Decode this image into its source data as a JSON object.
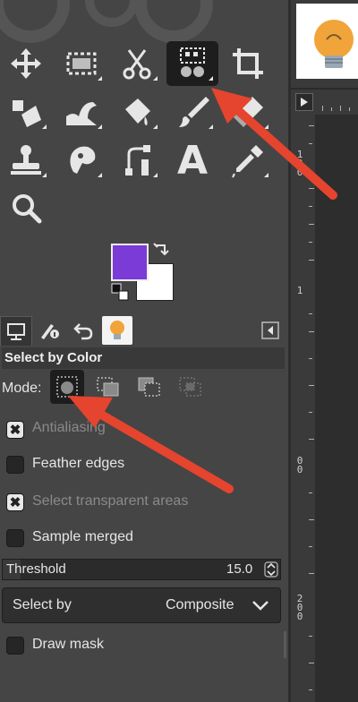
{
  "toolbox": {
    "tools": [
      {
        "name": "move-tool"
      },
      {
        "name": "rect-select-tool"
      },
      {
        "name": "scissors-select-tool"
      },
      {
        "name": "select-by-color-tool",
        "active": true
      },
      {
        "name": "crop-tool"
      },
      {
        "name": "unified-transform-tool"
      },
      {
        "name": "warp-transform-tool"
      },
      {
        "name": "bucket-fill-tool"
      },
      {
        "name": "paintbrush-tool"
      },
      {
        "name": "eraser-tool"
      },
      {
        "name": "clone-tool"
      },
      {
        "name": "smudge-tool"
      },
      {
        "name": "paths-tool"
      },
      {
        "name": "text-tool"
      },
      {
        "name": "color-picker-tool"
      },
      {
        "name": "zoom-tool"
      }
    ],
    "text_tool_glyph": "A"
  },
  "colors": {
    "foreground": "#7a3bd6",
    "background": "#ffffff"
  },
  "tool_options": {
    "title": "Select by Color",
    "mode_label": "Mode:",
    "antialiasing": {
      "label": "Antialiasing",
      "checked": true,
      "enabled": false
    },
    "feather_edges": {
      "label": "Feather edges",
      "checked": false
    },
    "select_transparent": {
      "label": "Select transparent areas",
      "checked": true,
      "enabled": false
    },
    "sample_merged": {
      "label": "Sample merged",
      "checked": false
    },
    "threshold": {
      "label": "Threshold",
      "value": "15.0"
    },
    "select_by": {
      "label": "Select by",
      "value": "Composite"
    },
    "draw_mask": {
      "label": "Draw mask",
      "checked": false
    },
    "check_mark": "✖"
  },
  "ruler": {
    "labels": [
      "1",
      "0",
      "0",
      "1",
      "0",
      "0",
      "2",
      "0",
      "0"
    ]
  },
  "accent": "#e5442e"
}
